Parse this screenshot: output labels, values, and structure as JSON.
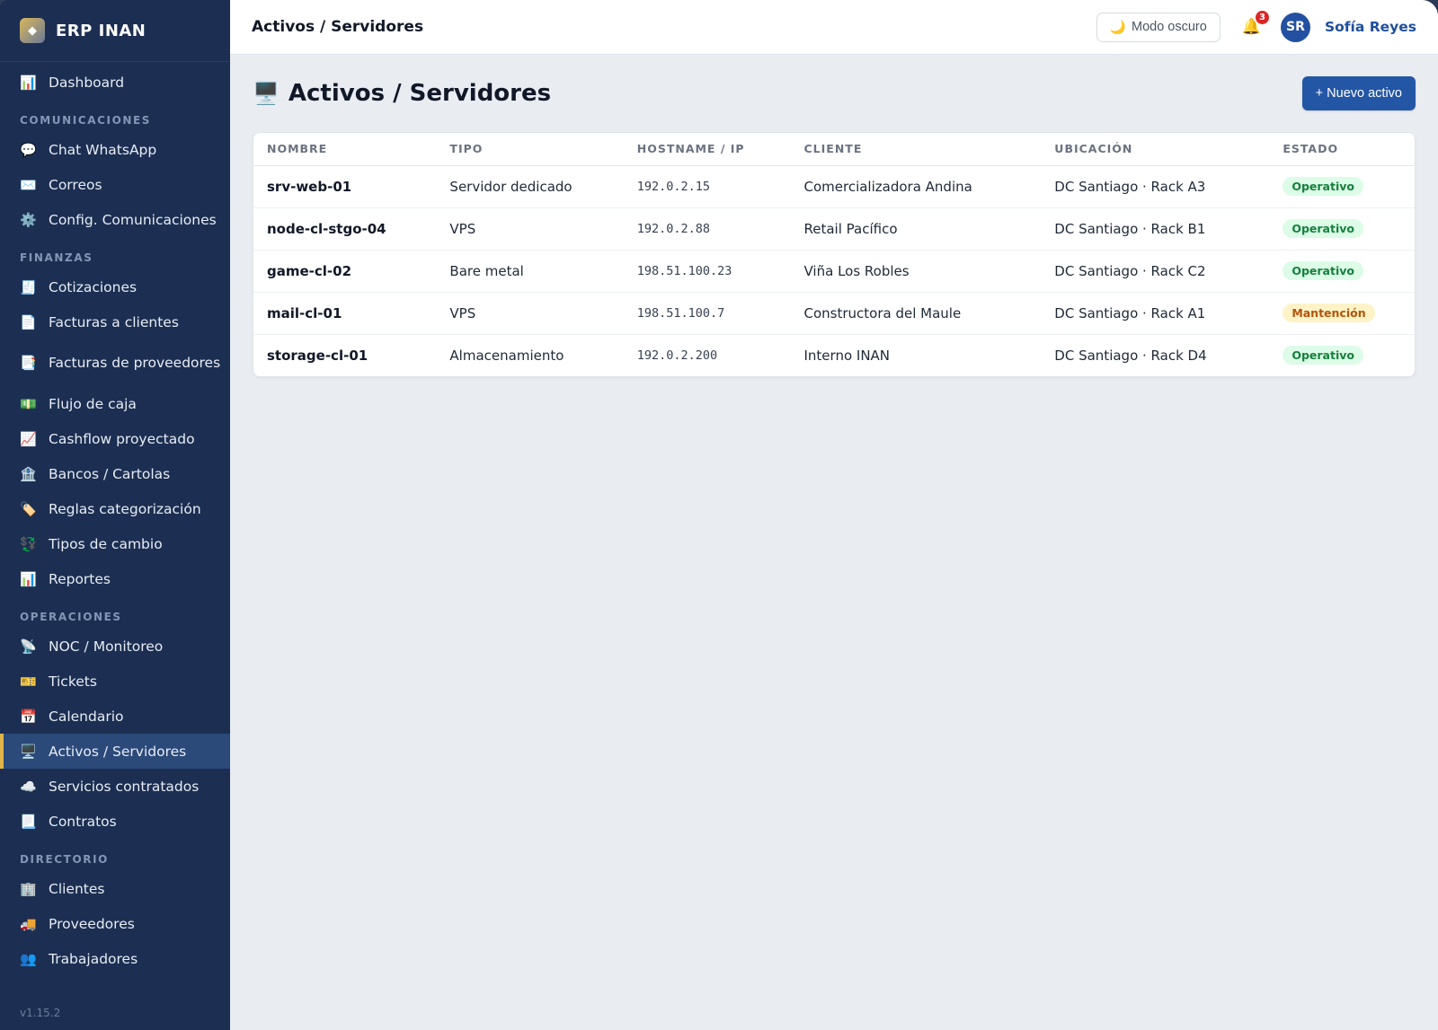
{
  "brand": {
    "name": "ERP INAN",
    "logo_glyph": "◆"
  },
  "sidebar": {
    "top": [
      {
        "label": "Dashboard",
        "icon": "📊",
        "icon_name": "dashboard-icon"
      }
    ],
    "comunicaciones": {
      "title": "COMUNICACIONES",
      "items": [
        {
          "label": "Chat WhatsApp",
          "icon": "💬",
          "icon_name": "chat-icon"
        },
        {
          "label": "Correos",
          "icon": "✉️",
          "icon_name": "mail-icon"
        },
        {
          "label": "Config. Comunicaciones",
          "icon": "⚙️",
          "icon_name": "gear-icon"
        }
      ]
    },
    "finanzas": {
      "title": "FINANZAS",
      "items": [
        {
          "label": "Cotizaciones",
          "icon": "🧾",
          "icon_name": "receipt-icon"
        },
        {
          "label": "Facturas a clientes",
          "icon": "📄",
          "icon_name": "document-icon"
        },
        {
          "label": "Facturas de proveedores",
          "icon": "📑",
          "icon_name": "documents-icon"
        },
        {
          "label": "Flujo de caja",
          "icon": "💵",
          "icon_name": "cash-icon"
        },
        {
          "label": "Cashflow proyectado",
          "icon": "📈",
          "icon_name": "chart-up-icon"
        },
        {
          "label": "Bancos / Cartolas",
          "icon": "🏦",
          "icon_name": "bank-icon"
        },
        {
          "label": "Reglas categorización",
          "icon": "🏷️",
          "icon_name": "tag-icon"
        },
        {
          "label": "Tipos de cambio",
          "icon": "💱",
          "icon_name": "currency-exchange-icon"
        },
        {
          "label": "Reportes",
          "icon": "📊",
          "icon_name": "report-icon"
        }
      ]
    },
    "operaciones": {
      "title": "OPERACIONES",
      "items": [
        {
          "label": "NOC / Monitoreo",
          "icon": "📡",
          "icon_name": "satellite-icon"
        },
        {
          "label": "Tickets",
          "icon": "🎫",
          "icon_name": "ticket-icon"
        },
        {
          "label": "Calendario",
          "icon": "📅",
          "icon_name": "calendar-icon"
        },
        {
          "label": "Activos / Servidores",
          "icon": "🖥️",
          "icon_name": "desktop-icon",
          "active": true
        },
        {
          "label": "Servicios contratados",
          "icon": "☁️",
          "icon_name": "cloud-icon"
        },
        {
          "label": "Contratos",
          "icon": "📃",
          "icon_name": "contract-icon"
        }
      ]
    },
    "directorio": {
      "title": "DIRECTORIO",
      "items": [
        {
          "label": "Clientes",
          "icon": "🏢",
          "icon_name": "building-icon"
        },
        {
          "label": "Proveedores",
          "icon": "🚚",
          "icon_name": "truck-icon"
        },
        {
          "label": "Trabajadores",
          "icon": "👥",
          "icon_name": "users-icon"
        }
      ]
    },
    "version": "v1.15.2"
  },
  "topbar": {
    "breadcrumb": "Activos / Servidores",
    "dark_mode_label": "Modo oscuro",
    "dark_mode_icon": "🌙",
    "bell_icon": "🔔",
    "notifications_count": "3",
    "avatar_initials": "SR",
    "user_name": "Sofía Reyes"
  },
  "page": {
    "title_icon": "🖥️",
    "title": "Activos / Servidores",
    "new_button": "+ Nuevo activo"
  },
  "table": {
    "headers": [
      "NOMBRE",
      "TIPO",
      "HOSTNAME / IP",
      "CLIENTE",
      "UBICACIÓN",
      "ESTADO"
    ],
    "rows": [
      {
        "nombre": "srv-web-01",
        "tipo": "Servidor dedicado",
        "ip": "192.0.2.15",
        "cliente": "Comercializadora Andina",
        "ubicacion": "DC Santiago · Rack A3",
        "estado": "Operativo",
        "estado_kind": "ok"
      },
      {
        "nombre": "node-cl-stgo-04",
        "tipo": "VPS",
        "ip": "192.0.2.88",
        "cliente": "Retail Pacífico",
        "ubicacion": "DC Santiago · Rack B1",
        "estado": "Operativo",
        "estado_kind": "ok"
      },
      {
        "nombre": "game-cl-02",
        "tipo": "Bare metal",
        "ip": "198.51.100.23",
        "cliente": "Viña Los Robles",
        "ubicacion": "DC Santiago · Rack C2",
        "estado": "Operativo",
        "estado_kind": "ok"
      },
      {
        "nombre": "mail-cl-01",
        "tipo": "VPS",
        "ip": "198.51.100.7",
        "cliente": "Constructora del Maule",
        "ubicacion": "DC Santiago · Rack A1",
        "estado": "Mantención",
        "estado_kind": "warn"
      },
      {
        "nombre": "storage-cl-01",
        "tipo": "Almacenamiento",
        "ip": "192.0.2.200",
        "cliente": "Interno INAN",
        "ubicacion": "DC Santiago · Rack D4",
        "estado": "Operativo",
        "estado_kind": "ok"
      }
    ]
  },
  "colors": {
    "sidebar_bg": "#1c2f52",
    "active_item_bg": "#2b4a7a",
    "active_accent": "#e0b54a",
    "primary": "#2456a6",
    "status_ok": "#15803d",
    "status_warn": "#b45309"
  }
}
